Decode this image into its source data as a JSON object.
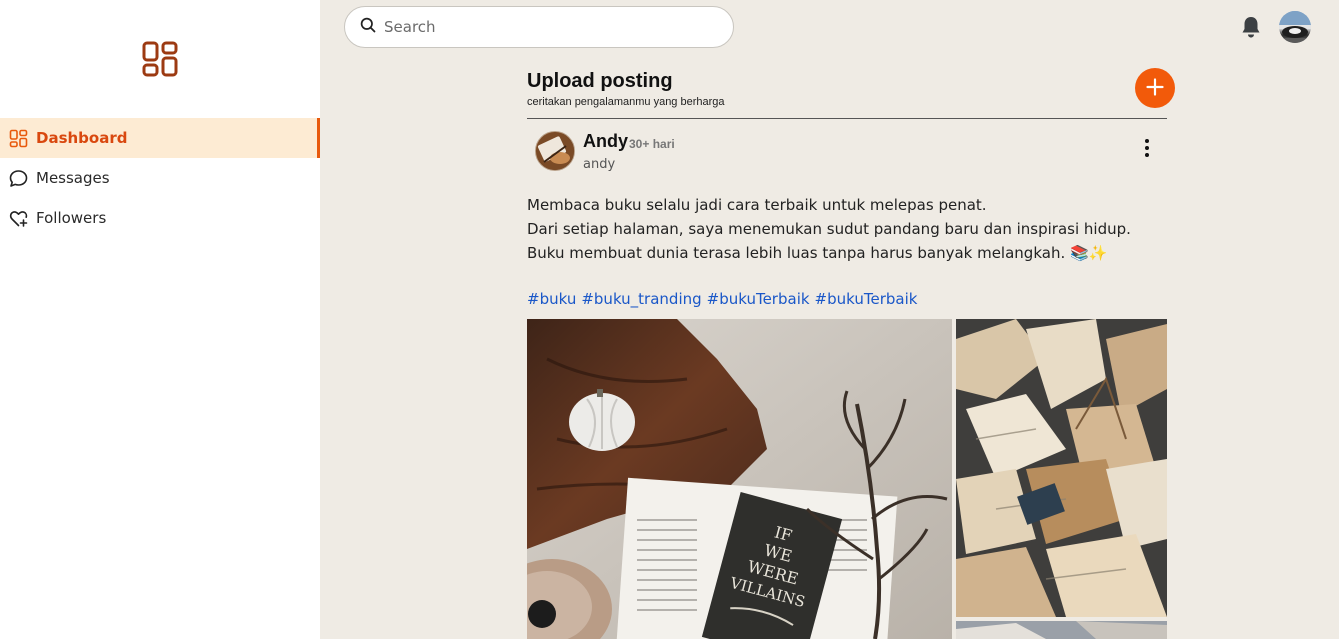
{
  "sidebar": {
    "logo_icon": "dashboard-grid-icon",
    "items": [
      {
        "label": "Dashboard",
        "icon": "dashboard-icon",
        "active": true
      },
      {
        "label": "Messages",
        "icon": "chat-bubble-icon",
        "active": false
      },
      {
        "label": "Followers",
        "icon": "heart-plus-icon",
        "active": false
      }
    ]
  },
  "header": {
    "search_placeholder": "Search",
    "notification_icon": "bell-icon",
    "avatar_icon": "user-avatar"
  },
  "upload": {
    "title": "Upload posting",
    "subtitle": "ceritakan pengalamanmu yang berharga",
    "add_icon": "plus-icon"
  },
  "post": {
    "author_name": "Andy",
    "time_ago": "30+ hari",
    "username": "andy",
    "body_lines": [
      "Membaca buku selalu jadi cara terbaik untuk melepas penat.",
      "Dari setiap halaman, saya menemukan sudut pandang baru dan inspirasi hidup.",
      "Buku membuat dunia terasa lebih luas tanpa harus banyak melangkah. 📚✨"
    ],
    "hashtags": [
      "#buku",
      "#buku_tranding",
      "#bukuTerbaik",
      "#bukuTerbaik"
    ],
    "book_title": "IF WE WERE VILLAINS"
  },
  "colors": {
    "accent": "#e8590c",
    "accent_bg": "#fdebd3",
    "page_bg": "#efebe4",
    "link": "#1a57c8",
    "fab": "#f25a0a"
  }
}
